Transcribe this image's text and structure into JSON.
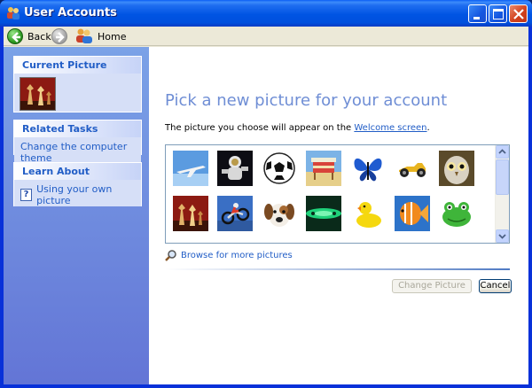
{
  "window": {
    "title": "User Accounts"
  },
  "toolbar": {
    "back_label": "Back",
    "home_label": "Home"
  },
  "sidebar": {
    "current_picture": {
      "title": "Current Picture"
    },
    "related_tasks": {
      "title": "Related Tasks",
      "items": [
        {
          "label": "Change the computer theme"
        }
      ]
    },
    "learn_about": {
      "title": "Learn About",
      "items": [
        {
          "label": "Using your own picture"
        }
      ]
    }
  },
  "main": {
    "title": "Pick a new picture for your account",
    "subtitle_prefix": "The picture you choose will appear on the ",
    "subtitle_link": "Welcome screen",
    "subtitle_suffix": ".",
    "pictures": [
      {
        "name": "airplane"
      },
      {
        "name": "astronaut"
      },
      {
        "name": "soccer-ball"
      },
      {
        "name": "beach-chair"
      },
      {
        "name": "butterfly"
      },
      {
        "name": "race-car"
      },
      {
        "name": "owl"
      },
      {
        "name": "chess"
      },
      {
        "name": "dirt-bike"
      },
      {
        "name": "dog"
      },
      {
        "name": "green-abstract"
      },
      {
        "name": "rubber-duck"
      },
      {
        "name": "fish"
      },
      {
        "name": "frog"
      }
    ],
    "browse_label": "Browse for more pictures",
    "change_button": "Change Picture",
    "cancel_button": "Cancel"
  },
  "colors": {
    "title_bar": "#0054e3",
    "accent": "#215dc6",
    "heading": "#6f8ed5"
  }
}
